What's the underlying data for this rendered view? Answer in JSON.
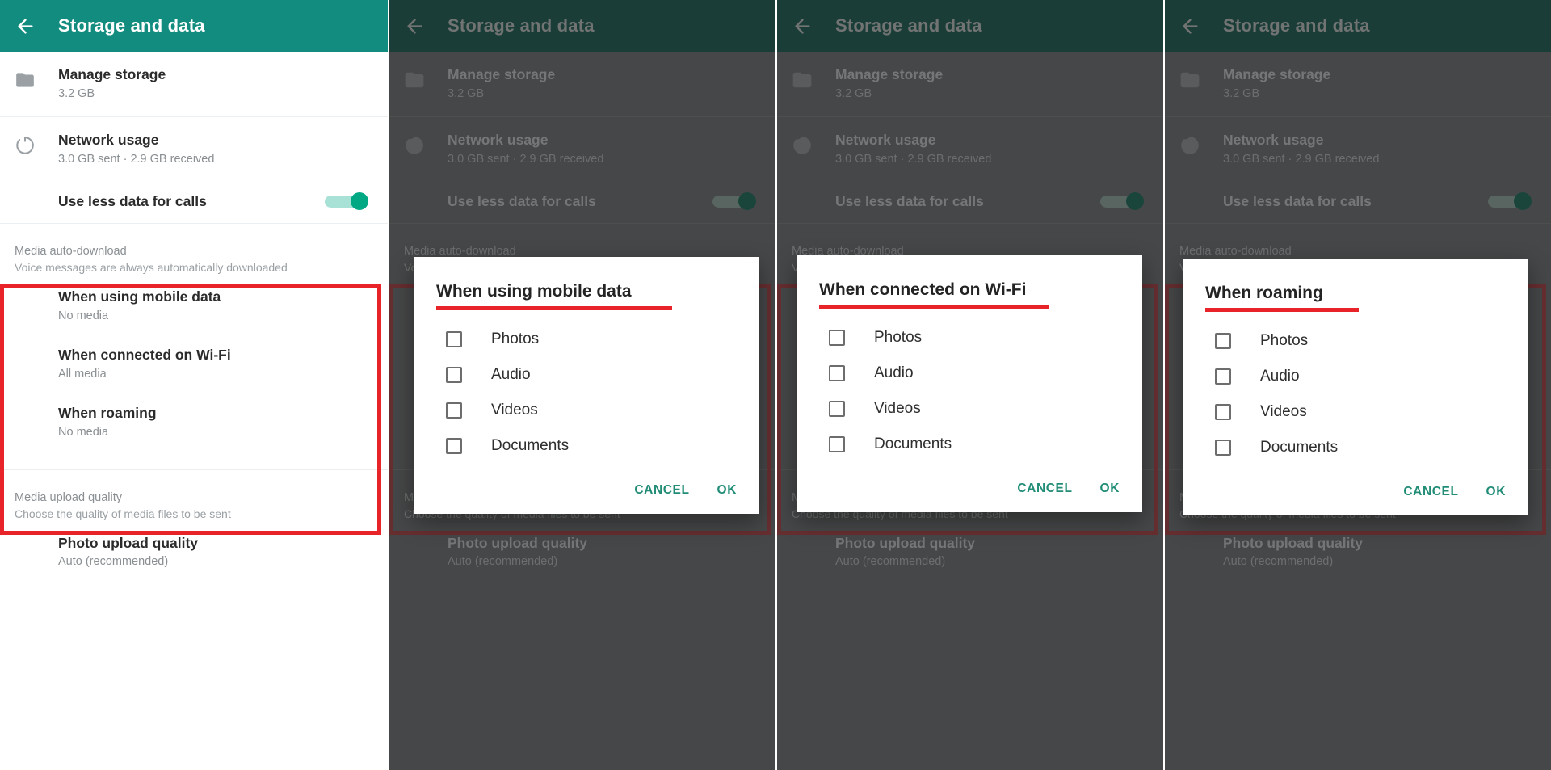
{
  "appbar": {
    "title": "Storage and data",
    "back_icon": "arrow-left-icon"
  },
  "colors": {
    "brand_green": "#128c7e",
    "accent_green": "#00a884",
    "highlight_red": "#e8232a",
    "dialog_action": "#218d77"
  },
  "settings": {
    "manage_storage": {
      "title": "Manage storage",
      "subtitle": "3.2 GB",
      "icon": "folder-icon"
    },
    "network_usage": {
      "title": "Network usage",
      "subtitle": "3.0 GB sent · 2.9 GB received",
      "icon": "data-usage-circle-icon"
    },
    "use_less_data": {
      "label": "Use less data for calls",
      "toggle_state": "on"
    },
    "media_auto_download": {
      "section_title": "Media auto-download",
      "section_subtitle": "Voice messages are always automatically downloaded",
      "options": [
        {
          "title": "When using mobile data",
          "subtitle": "No media"
        },
        {
          "title": "When connected on Wi-Fi",
          "subtitle": "All media"
        },
        {
          "title": "When roaming",
          "subtitle": "No media"
        }
      ]
    },
    "media_upload_quality": {
      "section_title": "Media upload quality",
      "section_subtitle": "Choose the quality of media files to be sent",
      "options": [
        {
          "title": "Photo upload quality",
          "subtitle": "Auto (recommended)"
        }
      ]
    }
  },
  "dialog_common": {
    "items": [
      "Photos",
      "Audio",
      "Videos",
      "Documents"
    ],
    "cancel_label": "CANCEL",
    "ok_label": "OK"
  },
  "panels": [
    {
      "id": "panel-1",
      "dimmed": false,
      "has_dialog": false,
      "has_redbox": true
    },
    {
      "id": "panel-2",
      "dimmed": true,
      "has_dialog": true,
      "dialog_title": "When using mobile data"
    },
    {
      "id": "panel-3",
      "dimmed": true,
      "has_dialog": true,
      "dialog_title": "When connected on Wi-Fi"
    },
    {
      "id": "panel-4",
      "dimmed": true,
      "has_dialog": true,
      "dialog_title": "When roaming"
    }
  ]
}
